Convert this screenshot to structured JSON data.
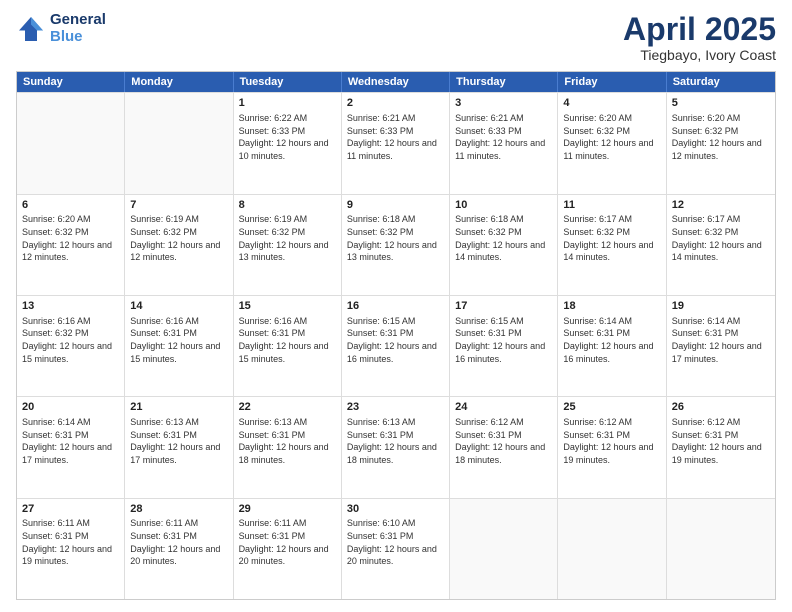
{
  "header": {
    "logo_general": "General",
    "logo_blue": "Blue",
    "title": "April 2025",
    "subtitle": "Tiegbayo, Ivory Coast"
  },
  "days": [
    "Sunday",
    "Monday",
    "Tuesday",
    "Wednesday",
    "Thursday",
    "Friday",
    "Saturday"
  ],
  "weeks": [
    [
      {
        "day": "",
        "info": ""
      },
      {
        "day": "",
        "info": ""
      },
      {
        "day": "1",
        "info": "Sunrise: 6:22 AM\nSunset: 6:33 PM\nDaylight: 12 hours and 10 minutes."
      },
      {
        "day": "2",
        "info": "Sunrise: 6:21 AM\nSunset: 6:33 PM\nDaylight: 12 hours and 11 minutes."
      },
      {
        "day": "3",
        "info": "Sunrise: 6:21 AM\nSunset: 6:33 PM\nDaylight: 12 hours and 11 minutes."
      },
      {
        "day": "4",
        "info": "Sunrise: 6:20 AM\nSunset: 6:32 PM\nDaylight: 12 hours and 11 minutes."
      },
      {
        "day": "5",
        "info": "Sunrise: 6:20 AM\nSunset: 6:32 PM\nDaylight: 12 hours and 12 minutes."
      }
    ],
    [
      {
        "day": "6",
        "info": "Sunrise: 6:20 AM\nSunset: 6:32 PM\nDaylight: 12 hours and 12 minutes."
      },
      {
        "day": "7",
        "info": "Sunrise: 6:19 AM\nSunset: 6:32 PM\nDaylight: 12 hours and 12 minutes."
      },
      {
        "day": "8",
        "info": "Sunrise: 6:19 AM\nSunset: 6:32 PM\nDaylight: 12 hours and 13 minutes."
      },
      {
        "day": "9",
        "info": "Sunrise: 6:18 AM\nSunset: 6:32 PM\nDaylight: 12 hours and 13 minutes."
      },
      {
        "day": "10",
        "info": "Sunrise: 6:18 AM\nSunset: 6:32 PM\nDaylight: 12 hours and 14 minutes."
      },
      {
        "day": "11",
        "info": "Sunrise: 6:17 AM\nSunset: 6:32 PM\nDaylight: 12 hours and 14 minutes."
      },
      {
        "day": "12",
        "info": "Sunrise: 6:17 AM\nSunset: 6:32 PM\nDaylight: 12 hours and 14 minutes."
      }
    ],
    [
      {
        "day": "13",
        "info": "Sunrise: 6:16 AM\nSunset: 6:32 PM\nDaylight: 12 hours and 15 minutes."
      },
      {
        "day": "14",
        "info": "Sunrise: 6:16 AM\nSunset: 6:31 PM\nDaylight: 12 hours and 15 minutes."
      },
      {
        "day": "15",
        "info": "Sunrise: 6:16 AM\nSunset: 6:31 PM\nDaylight: 12 hours and 15 minutes."
      },
      {
        "day": "16",
        "info": "Sunrise: 6:15 AM\nSunset: 6:31 PM\nDaylight: 12 hours and 16 minutes."
      },
      {
        "day": "17",
        "info": "Sunrise: 6:15 AM\nSunset: 6:31 PM\nDaylight: 12 hours and 16 minutes."
      },
      {
        "day": "18",
        "info": "Sunrise: 6:14 AM\nSunset: 6:31 PM\nDaylight: 12 hours and 16 minutes."
      },
      {
        "day": "19",
        "info": "Sunrise: 6:14 AM\nSunset: 6:31 PM\nDaylight: 12 hours and 17 minutes."
      }
    ],
    [
      {
        "day": "20",
        "info": "Sunrise: 6:14 AM\nSunset: 6:31 PM\nDaylight: 12 hours and 17 minutes."
      },
      {
        "day": "21",
        "info": "Sunrise: 6:13 AM\nSunset: 6:31 PM\nDaylight: 12 hours and 17 minutes."
      },
      {
        "day": "22",
        "info": "Sunrise: 6:13 AM\nSunset: 6:31 PM\nDaylight: 12 hours and 18 minutes."
      },
      {
        "day": "23",
        "info": "Sunrise: 6:13 AM\nSunset: 6:31 PM\nDaylight: 12 hours and 18 minutes."
      },
      {
        "day": "24",
        "info": "Sunrise: 6:12 AM\nSunset: 6:31 PM\nDaylight: 12 hours and 18 minutes."
      },
      {
        "day": "25",
        "info": "Sunrise: 6:12 AM\nSunset: 6:31 PM\nDaylight: 12 hours and 19 minutes."
      },
      {
        "day": "26",
        "info": "Sunrise: 6:12 AM\nSunset: 6:31 PM\nDaylight: 12 hours and 19 minutes."
      }
    ],
    [
      {
        "day": "27",
        "info": "Sunrise: 6:11 AM\nSunset: 6:31 PM\nDaylight: 12 hours and 19 minutes."
      },
      {
        "day": "28",
        "info": "Sunrise: 6:11 AM\nSunset: 6:31 PM\nDaylight: 12 hours and 20 minutes."
      },
      {
        "day": "29",
        "info": "Sunrise: 6:11 AM\nSunset: 6:31 PM\nDaylight: 12 hours and 20 minutes."
      },
      {
        "day": "30",
        "info": "Sunrise: 6:10 AM\nSunset: 6:31 PM\nDaylight: 12 hours and 20 minutes."
      },
      {
        "day": "",
        "info": ""
      },
      {
        "day": "",
        "info": ""
      },
      {
        "day": "",
        "info": ""
      }
    ]
  ]
}
